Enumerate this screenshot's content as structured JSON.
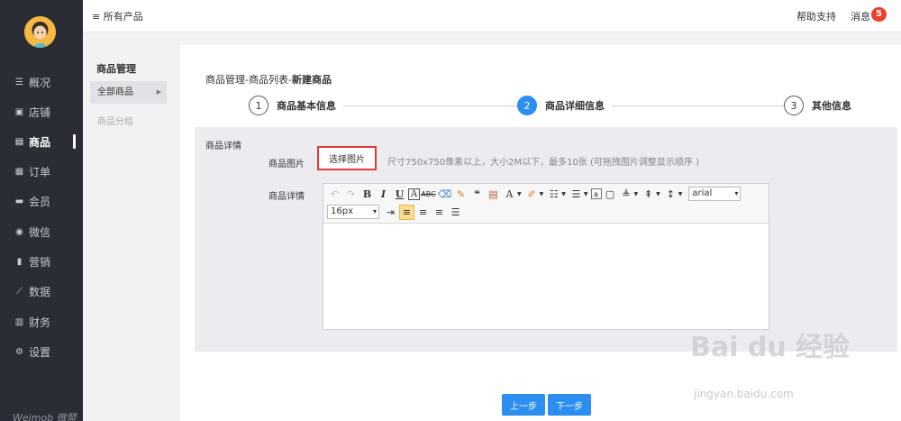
{
  "sidebar": {
    "brand": "Weimob 微盟",
    "items": [
      {
        "label": "概况",
        "icon": "overview-icon",
        "glyph": "☰"
      },
      {
        "label": "店铺",
        "icon": "store-icon",
        "glyph": "▣"
      },
      {
        "label": "商品",
        "icon": "goods-icon",
        "glyph": "▤"
      },
      {
        "label": "订单",
        "icon": "order-icon",
        "glyph": "▦"
      },
      {
        "label": "会员",
        "icon": "member-icon",
        "glyph": "▬"
      },
      {
        "label": "微信",
        "icon": "wechat-icon",
        "glyph": "◉"
      },
      {
        "label": "营销",
        "icon": "marketing-icon",
        "glyph": "▮"
      },
      {
        "label": "数据",
        "icon": "data-icon",
        "glyph": "⟋"
      },
      {
        "label": "财务",
        "icon": "finance-icon",
        "glyph": "▥"
      },
      {
        "label": "设置",
        "icon": "settings-icon",
        "glyph": "⚙"
      }
    ]
  },
  "topbar": {
    "all_products": "≡ 所有产品",
    "help": "帮助支持",
    "messages": "消息",
    "message_count": "5"
  },
  "subnav": {
    "title": "商品管理",
    "item_active": "全部商品",
    "item_2": "商品分组"
  },
  "main": {
    "breadcrumb_prefix": "商品管理-商品列表-",
    "breadcrumb_current": "新建商品",
    "steps": [
      {
        "num": "1",
        "label": "商品基本信息"
      },
      {
        "num": "2",
        "label": "商品详细信息"
      },
      {
        "num": "3",
        "label": "其他信息"
      }
    ],
    "panel_title": "商品详情",
    "image_label": "商品图片",
    "choose_image_button": "选择图片",
    "image_hint": "尺寸750x750像素以上，大小2M以下，最多10张 (可拖拽图片调整显示顺序 )",
    "detail_label": "商品详情",
    "editor": {
      "font_family": "arial",
      "font_size": "16px"
    },
    "prev_button": "上一步",
    "next_button": "下一步"
  },
  "watermark": {
    "text": "Bai du 经验",
    "sub": "jingyan.baidu.com"
  },
  "colors": {
    "sidebar_bg": "#2a2d36",
    "accent_blue": "#2b8ef0",
    "badge_red": "#e8412c",
    "highlight_border": "#e03a3a"
  }
}
